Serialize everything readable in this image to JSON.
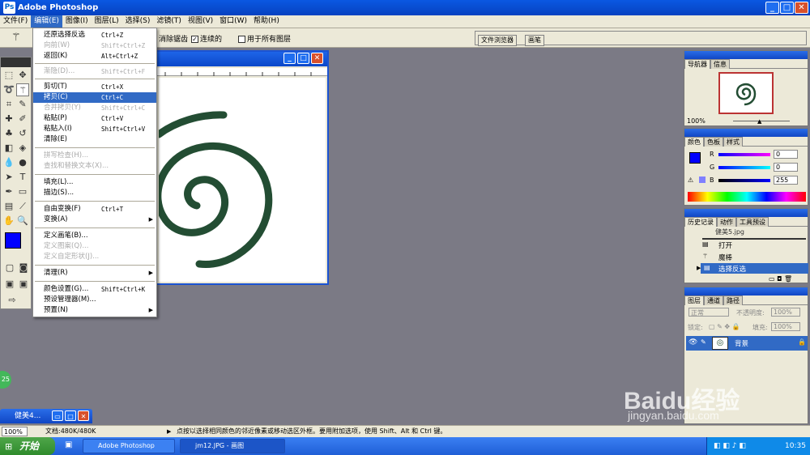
{
  "app": {
    "title": "Adobe Photoshop"
  },
  "menubar": [
    "文件(F)",
    "编辑(E)",
    "图像(I)",
    "图层(L)",
    "选择(S)",
    "滤镜(T)",
    "视图(V)",
    "窗口(W)",
    "帮助(H)"
  ],
  "options": {
    "antialias": "消除锯齿",
    "contiguous": "连续的",
    "all_layers": "用于所有图层",
    "tab1": "文件浏览器",
    "tab2": "画笔"
  },
  "edit_menu": [
    {
      "label": "还原选择反选",
      "shortcut": "Ctrl+Z",
      "state": "normal"
    },
    {
      "label": "向前(W)",
      "shortcut": "Shift+Ctrl+Z",
      "state": "disabled"
    },
    {
      "label": "返回(K)",
      "shortcut": "Alt+Ctrl+Z",
      "state": "normal"
    },
    {
      "label": "渐隐(D)...",
      "shortcut": "Shift+Ctrl+F",
      "state": "disabled"
    },
    {
      "label": "剪切(T)",
      "shortcut": "Ctrl+X",
      "state": "normal"
    },
    {
      "label": "拷贝(C)",
      "shortcut": "Ctrl+C",
      "state": "highlighted"
    },
    {
      "label": "合并拷贝(Y)",
      "shortcut": "Shift+Ctrl+C",
      "state": "disabled"
    },
    {
      "label": "粘贴(P)",
      "shortcut": "Ctrl+V",
      "state": "normal"
    },
    {
      "label": "粘贴入(I)",
      "shortcut": "Shift+Ctrl+V",
      "state": "normal"
    },
    {
      "label": "清除(E)",
      "shortcut": "",
      "state": "normal"
    },
    {
      "label": "拼写检查(H)...",
      "shortcut": "",
      "state": "disabled"
    },
    {
      "label": "查找和替换文本(X)...",
      "shortcut": "",
      "state": "disabled"
    },
    {
      "label": "填充(L)...",
      "shortcut": "",
      "state": "normal"
    },
    {
      "label": "描边(S)...",
      "shortcut": "",
      "state": "normal"
    },
    {
      "label": "自由变换(F)",
      "shortcut": "Ctrl+T",
      "state": "normal"
    },
    {
      "label": "变换(A)",
      "shortcut": "",
      "state": "submenu"
    },
    {
      "label": "定义画笔(B)...",
      "shortcut": "",
      "state": "normal"
    },
    {
      "label": "定义图案(Q)...",
      "shortcut": "",
      "state": "disabled"
    },
    {
      "label": "定义自定形状(J)...",
      "shortcut": "",
      "state": "disabled"
    },
    {
      "label": "清理(R)",
      "shortcut": "",
      "state": "submenu"
    },
    {
      "label": "颜色设置(G)...",
      "shortcut": "Shift+Ctrl+K",
      "state": "normal"
    },
    {
      "label": "预设管理器(M)...",
      "shortcut": "",
      "state": "normal"
    },
    {
      "label": "预置(N)",
      "shortcut": "",
      "state": "submenu"
    }
  ],
  "navigator": {
    "tabs": [
      "导航器",
      "信息"
    ],
    "zoom": "100%"
  },
  "color": {
    "tabs": [
      "颜色",
      "色板",
      "样式"
    ],
    "r_label": "R",
    "g_label": "G",
    "b_label": "B",
    "r": "0",
    "g": "0",
    "b": "255",
    "swatch": "#0000ff"
  },
  "history": {
    "tabs": [
      "历史记录",
      "动作",
      "工具预设"
    ],
    "snapshot": "健美5.jpg",
    "items": [
      "打开",
      "魔棒",
      "选择反选"
    ]
  },
  "layers": {
    "tabs": [
      "图层",
      "通道",
      "路径"
    ],
    "mode": "正常",
    "opacity_label": "不透明度:",
    "opacity": "100%",
    "lock_label": "锁定:",
    "fill_label": "填充:",
    "fill": "100%",
    "layer_name": "背景"
  },
  "minimized_doc": "健美4...",
  "status": {
    "zoom": "100%",
    "doc": "文档:480K/480K",
    "hint": "点按以选择相同颜色的邻近像素或移动选区外框。要用附加选项，使用 Shift、Alt 和 Ctrl 键。"
  },
  "taskbar": {
    "start": "开始",
    "task1": "Adobe Photoshop",
    "task2": "jm12.JPG - 画图",
    "clock": "10:35"
  },
  "watermark": {
    "text": "Baidu经验",
    "url": "jingyan.baidu.com"
  },
  "badge": "25"
}
